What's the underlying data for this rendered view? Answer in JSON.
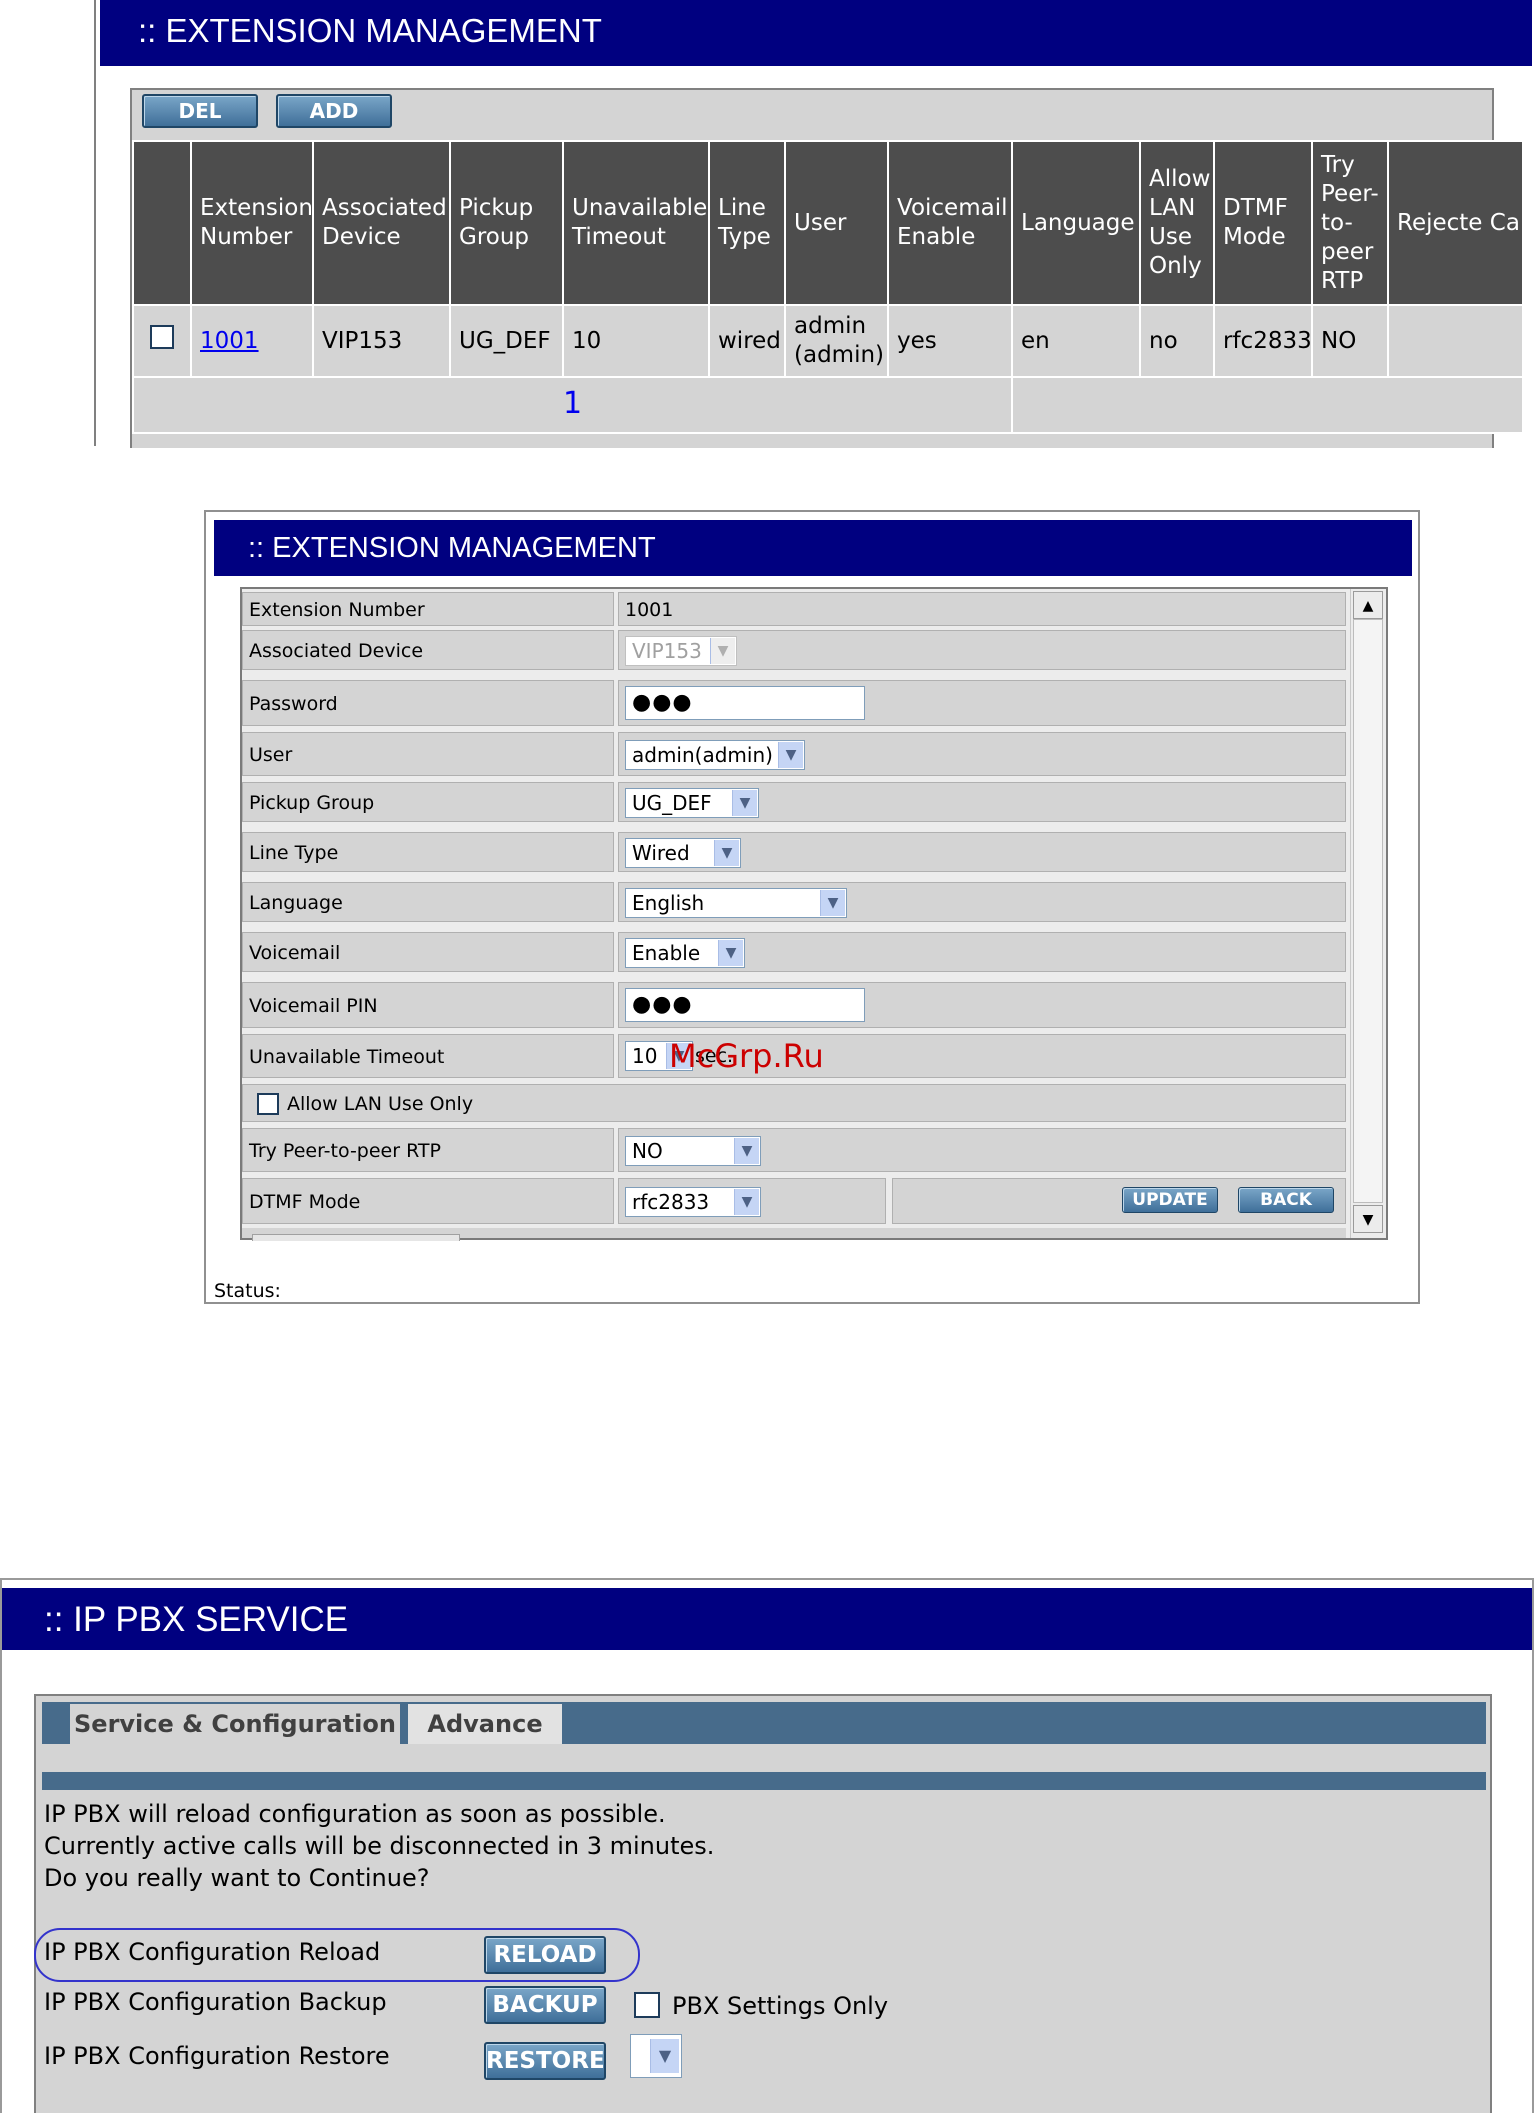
{
  "panel1": {
    "title": ":: EXTENSION MANAGEMENT",
    "del_label": "DEL",
    "add_label": "ADD",
    "columns": [
      "",
      "Extension Number",
      "Associated Device",
      "Pickup Group",
      "Unavailable Timeout",
      "Line Type",
      "User",
      "Voicemail Enable",
      "Language",
      "Allow LAN Use Only",
      "DTMF Mode",
      "Try Peer-to-peer RTP",
      "Rejecte Caller"
    ],
    "row": {
      "extension": "1001",
      "device": "VIP153",
      "pickup": "UG_DEF",
      "timeout": "10",
      "line_type": "wired",
      "user": "admin (admin)",
      "voicemail": "yes",
      "language": "en",
      "allow_lan": "no",
      "dtmf": "rfc2833",
      "peer_rtp": "NO",
      "rejected": ""
    },
    "page": "1"
  },
  "panel2": {
    "title": ":: EXTENSION MANAGEMENT",
    "labels": {
      "extension_number": "Extension Number",
      "associated_device": "Associated Device",
      "password": "Password",
      "user": "User",
      "pickup_group": "Pickup Group",
      "line_type": "Line Type",
      "language": "Language",
      "voicemail": "Voicemail",
      "voicemail_pin": "Voicemail PIN",
      "unavailable_timeout": "Unavailable Timeout",
      "allow_lan": "Allow LAN Use Only",
      "peer_rtp": "Try Peer-to-peer RTP",
      "dtmf_mode": "DTMF Mode"
    },
    "values": {
      "extension_number": "1001",
      "associated_device": "VIP153",
      "password": "●●●",
      "user": "admin(admin)",
      "pickup_group": "UG_DEF",
      "line_type": "Wired",
      "language": "English",
      "voicemail": "Enable",
      "voicemail_pin": "●●●",
      "unavailable_timeout": "10",
      "timeout_unit": "sec.",
      "peer_rtp": "NO",
      "dtmf_mode": "rfc2833"
    },
    "update_label": "UPDATE",
    "back_label": "BACK",
    "status_label": "Status:",
    "watermark": "McGrp.Ru"
  },
  "panel3": {
    "title": ":: IP PBX SERVICE",
    "tabs": [
      "Service & Configuration",
      "Advance"
    ],
    "message": [
      "IP PBX will reload configuration as soon as possible.",
      "Currently active calls will be disconnected in 3 minutes.",
      "Do you really want to Continue?"
    ],
    "reload_label": "IP PBX Configuration Reload",
    "reload_button": "RELOAD",
    "backup_label": "IP PBX Configuration Backup",
    "backup_button": "BACKUP",
    "pbx_settings_only": "PBX Settings Only",
    "restore_label": "IP PBX Configuration Restore",
    "restore_button": "RESTORE"
  }
}
